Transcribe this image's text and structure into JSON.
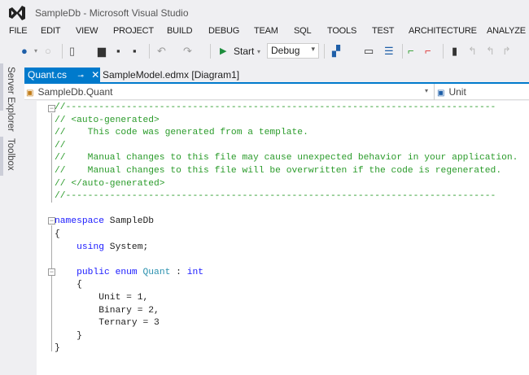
{
  "window": {
    "title": "SampleDb - Microsoft Visual Studio"
  },
  "menu": [
    "FILE",
    "EDIT",
    "VIEW",
    "PROJECT",
    "BUILD",
    "DEBUG",
    "TEAM",
    "SQL",
    "TOOLS",
    "TEST",
    "ARCHITECTURE",
    "ANALYZE"
  ],
  "toolbar": {
    "start_label": "Start",
    "config_value": "Debug"
  },
  "side_tabs": [
    "Server Explorer",
    "Toolbox"
  ],
  "tabs": [
    {
      "label": "Quant.cs",
      "active": true
    },
    {
      "label": "SampleModel.edmx [Diagram1]",
      "active": false
    }
  ],
  "nav": {
    "type": "SampleDb.Quant",
    "member": "Unit"
  },
  "code": [
    [
      [
        "c",
        "//------------------------------------------------------------------------------"
      ]
    ],
    [
      [
        "c",
        "// <auto-generated>"
      ]
    ],
    [
      [
        "c",
        "//    This code was generated from a template."
      ]
    ],
    [
      [
        "c",
        "//"
      ]
    ],
    [
      [
        "c",
        "//    Manual changes to this file may cause unexpected behavior in your application."
      ]
    ],
    [
      [
        "c",
        "//    Manual changes to this file will be overwritten if the code is regenerated."
      ]
    ],
    [
      [
        "c",
        "// </auto-generated>"
      ]
    ],
    [
      [
        "c",
        "//------------------------------------------------------------------------------"
      ]
    ],
    [],
    [
      [
        "k",
        "namespace"
      ],
      [
        "p",
        " SampleDb"
      ]
    ],
    [
      [
        "p",
        "{"
      ]
    ],
    [
      [
        "p",
        "    "
      ],
      [
        "k",
        "using"
      ],
      [
        "p",
        " System;"
      ]
    ],
    [],
    [
      [
        "p",
        "    "
      ],
      [
        "k",
        "public"
      ],
      [
        "p",
        " "
      ],
      [
        "k",
        "enum"
      ],
      [
        "p",
        " "
      ],
      [
        "t",
        "Quant"
      ],
      [
        "p",
        " : "
      ],
      [
        "k",
        "int"
      ]
    ],
    [
      [
        "p",
        "    {"
      ]
    ],
    [
      [
        "p",
        "        Unit = 1,"
      ]
    ],
    [
      [
        "p",
        "        Binary = 2,"
      ]
    ],
    [
      [
        "p",
        "        Ternary = 3"
      ]
    ],
    [
      [
        "p",
        "    }"
      ]
    ],
    [
      [
        "p",
        "}"
      ]
    ]
  ]
}
